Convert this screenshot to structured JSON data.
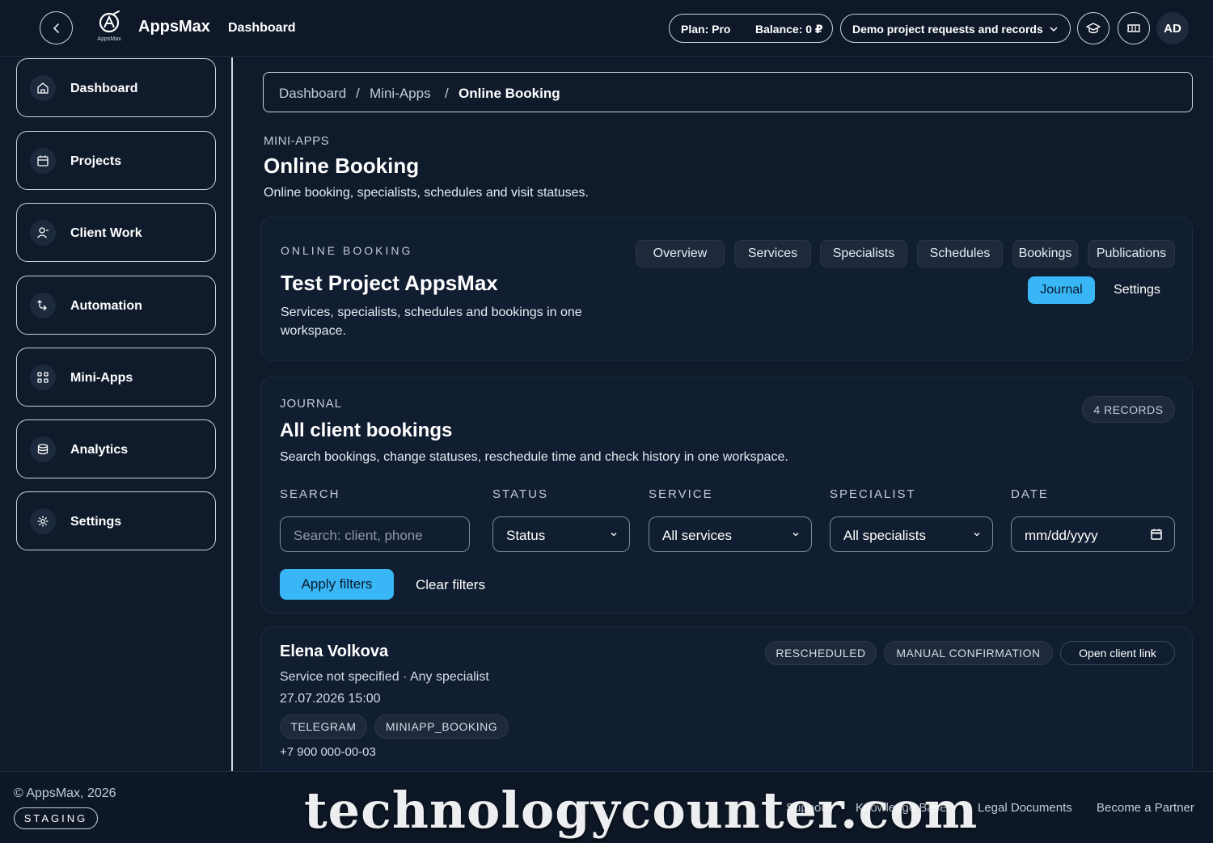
{
  "topbar": {
    "app_name": "AppsMax",
    "logo_sub": "AppsMax",
    "title": "Dashboard",
    "plan": "Plan: Pro",
    "balance": "Balance: 0 ₽",
    "project_select": "Demo project requests and records",
    "avatar": "AD"
  },
  "sidebar": {
    "items": [
      {
        "label": "Dashboard",
        "icon": "home-icon"
      },
      {
        "label": "Projects",
        "icon": "calendar-icon"
      },
      {
        "label": "Client Work",
        "icon": "user-icon"
      },
      {
        "label": "Automation",
        "icon": "automation-icon"
      },
      {
        "label": "Mini-Apps",
        "icon": "grid-icon"
      },
      {
        "label": "Analytics",
        "icon": "database-icon"
      },
      {
        "label": "Settings",
        "icon": "gear-icon"
      }
    ]
  },
  "breadcrumb": {
    "items": [
      "Dashboard",
      "Mini-Apps",
      "Online Booking"
    ],
    "separator": "/"
  },
  "header": {
    "eyebrow": "MINI-APPS",
    "title": "Online Booking",
    "description": "Online booking, specialists, schedules and visit statuses."
  },
  "overview_card": {
    "eyebrow": "ONLINE BOOKING",
    "title": "Test Project AppsMax",
    "description": "Services, specialists, schedules and bookings in one workspace.",
    "tabs": [
      "Overview",
      "Services",
      "Specialists",
      "Schedules",
      "Bookings",
      "Publications",
      "Journal",
      "Settings"
    ],
    "active_tab": "Journal"
  },
  "journal": {
    "eyebrow": "JOURNAL",
    "title": "All client bookings",
    "description": "Search bookings, change statuses, reschedule time and check history in one workspace.",
    "records_badge": "4 RECORDS",
    "filters": {
      "search_label": "SEARCH",
      "search_placeholder": "Search: client, phone",
      "status_label": "STATUS",
      "status_value": "Status",
      "service_label": "SERVICE",
      "service_value": "All services",
      "specialist_label": "SPECIALIST",
      "specialist_value": "All specialists",
      "date_label": "DATE",
      "date_placeholder": "mm/dd/yyyy"
    },
    "apply_label": "Apply filters",
    "clear_label": "Clear filters"
  },
  "booking": {
    "client_name": "Elena Volkova",
    "service_line": "Service not specified · Any specialist",
    "datetime": "27.07.2026 15:00",
    "tags": [
      "TELEGRAM",
      "MINIAPP_BOOKING"
    ],
    "phone": "+7 900 000-00-03",
    "status_badges": [
      "RESCHEDULED",
      "MANUAL CONFIRMATION"
    ],
    "open_link_label": "Open client link"
  },
  "footer": {
    "copyright": "© AppsMax, 2026",
    "env_badge": "STAGING",
    "links": [
      "Support",
      "Knowledge Base",
      "Legal Documents",
      "Become a Partner"
    ]
  },
  "watermark": "technologycounter.com",
  "colors": {
    "background": "#0f1a2b",
    "accent": "#38b6f5",
    "card": "#111d30"
  }
}
